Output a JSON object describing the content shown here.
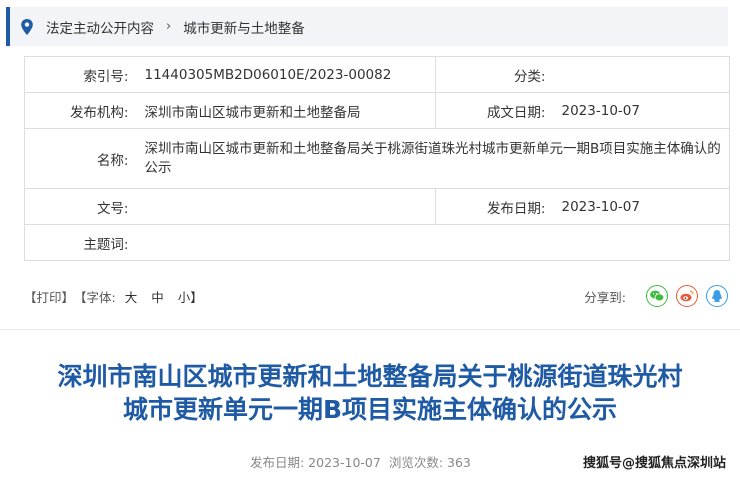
{
  "breadcrumb": {
    "items": [
      "法定主动公开内容",
      "城市更新与土地整备"
    ],
    "separator": "›"
  },
  "meta": {
    "index_label": "索引号:",
    "index_value": "11440305MB2D06010E/2023-00082",
    "category_label": "分类:",
    "category_value": "",
    "publisher_label": "发布机构:",
    "publisher_value": "深圳市南山区城市更新和土地整备局",
    "created_label": "成文日期:",
    "created_value": "2023-10-07",
    "name_label": "名称:",
    "name_value": "深圳市南山区城市更新和土地整备局关于桃源街道珠光村城市更新单元一期B项目实施主体确认的公示",
    "doc_no_label": "文号:",
    "doc_no_value": "",
    "published_label": "发布日期:",
    "published_value": "2023-10-07",
    "subject_label": "主题词:",
    "subject_value": ""
  },
  "tools": {
    "print": "【打印】",
    "font_open": "【字体:",
    "font_large": "大",
    "font_medium": "中",
    "font_small": "小】",
    "share_label": "分享到:"
  },
  "colors": {
    "accent": "#1f5aa5",
    "wechat": "#3dbb3d",
    "weibo": "#e8593a",
    "qq": "#3a9ce8"
  },
  "article": {
    "title_line1": "深圳市南山区城市更新和土地整备局关于桃源街道珠光村",
    "title_line2": "城市更新单元一期B项目实施主体确认的公示",
    "publish_text": "发布日期: 2023-10-07",
    "views_text": "浏览次数: 363"
  },
  "watermark": "搜狐号@搜狐焦点深圳站"
}
